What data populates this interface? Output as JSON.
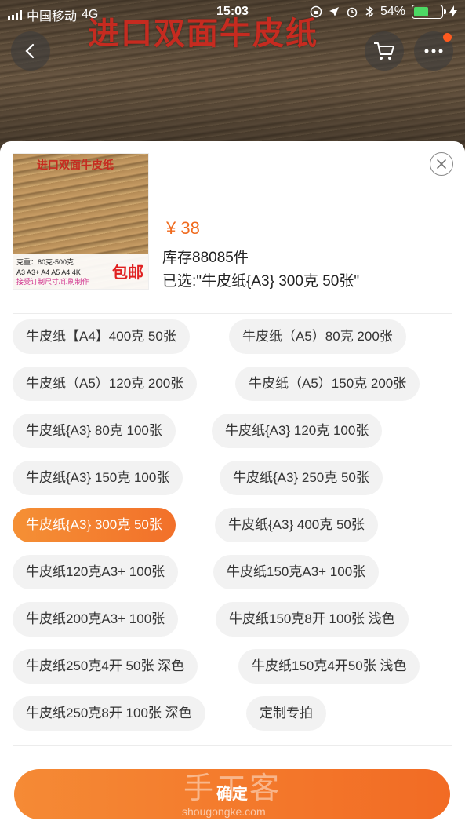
{
  "status_bar": {
    "carrier": "中国移动",
    "network": "4G",
    "time": "15:03",
    "battery": "54%"
  },
  "hero": {
    "title": "进口双面牛皮纸"
  },
  "product": {
    "thumb_title": "进口双面牛皮纸",
    "thumb_line1": "克重：80克-500克",
    "thumb_line2": "A3 A3+ A4 A5 A4 4K",
    "thumb_line3": "接受订制尺寸/印刷制作",
    "thumb_badge": "包邮",
    "price": "¥ 38",
    "stock": "库存88085件",
    "selected": "已选:\"牛皮纸{A3} 300克 50张\""
  },
  "options": [
    {
      "label": "牛皮纸【A4】400克 50张",
      "selected": false
    },
    {
      "label": "牛皮纸（A5）80克 200张",
      "selected": false
    },
    {
      "label": "牛皮纸（A5）120克 200张",
      "selected": false
    },
    {
      "label": "牛皮纸（A5）150克 200张",
      "selected": false
    },
    {
      "label": "牛皮纸{A3} 80克 100张",
      "selected": false
    },
    {
      "label": "牛皮纸{A3} 120克 100张",
      "selected": false
    },
    {
      "label": "牛皮纸{A3} 150克 100张",
      "selected": false
    },
    {
      "label": "牛皮纸{A3} 250克 50张",
      "selected": false
    },
    {
      "label": "牛皮纸{A3} 300克 50张",
      "selected": true
    },
    {
      "label": "牛皮纸{A3} 400克 50张",
      "selected": false
    },
    {
      "label": "牛皮纸120克A3+ 100张",
      "selected": false
    },
    {
      "label": "牛皮纸150克A3+ 100张",
      "selected": false
    },
    {
      "label": "牛皮纸200克A3+ 100张",
      "selected": false
    },
    {
      "label": "牛皮纸150克8开 100张 浅色",
      "selected": false
    },
    {
      "label": "牛皮纸250克4开 50张 深色",
      "selected": false
    },
    {
      "label": "牛皮纸150克4开50张 浅色",
      "selected": false
    },
    {
      "label": "牛皮纸250克8开 100张 深色",
      "selected": false
    },
    {
      "label": "定制专拍",
      "selected": false
    }
  ],
  "confirm_label": "确定",
  "watermark": {
    "name": "手工客",
    "url": "shougongke.com"
  },
  "colors": {
    "accent": "#f2702a",
    "price": "#f06a1d"
  },
  "icons": [
    "back-icon",
    "cart-icon",
    "more-icon",
    "close-icon"
  ]
}
